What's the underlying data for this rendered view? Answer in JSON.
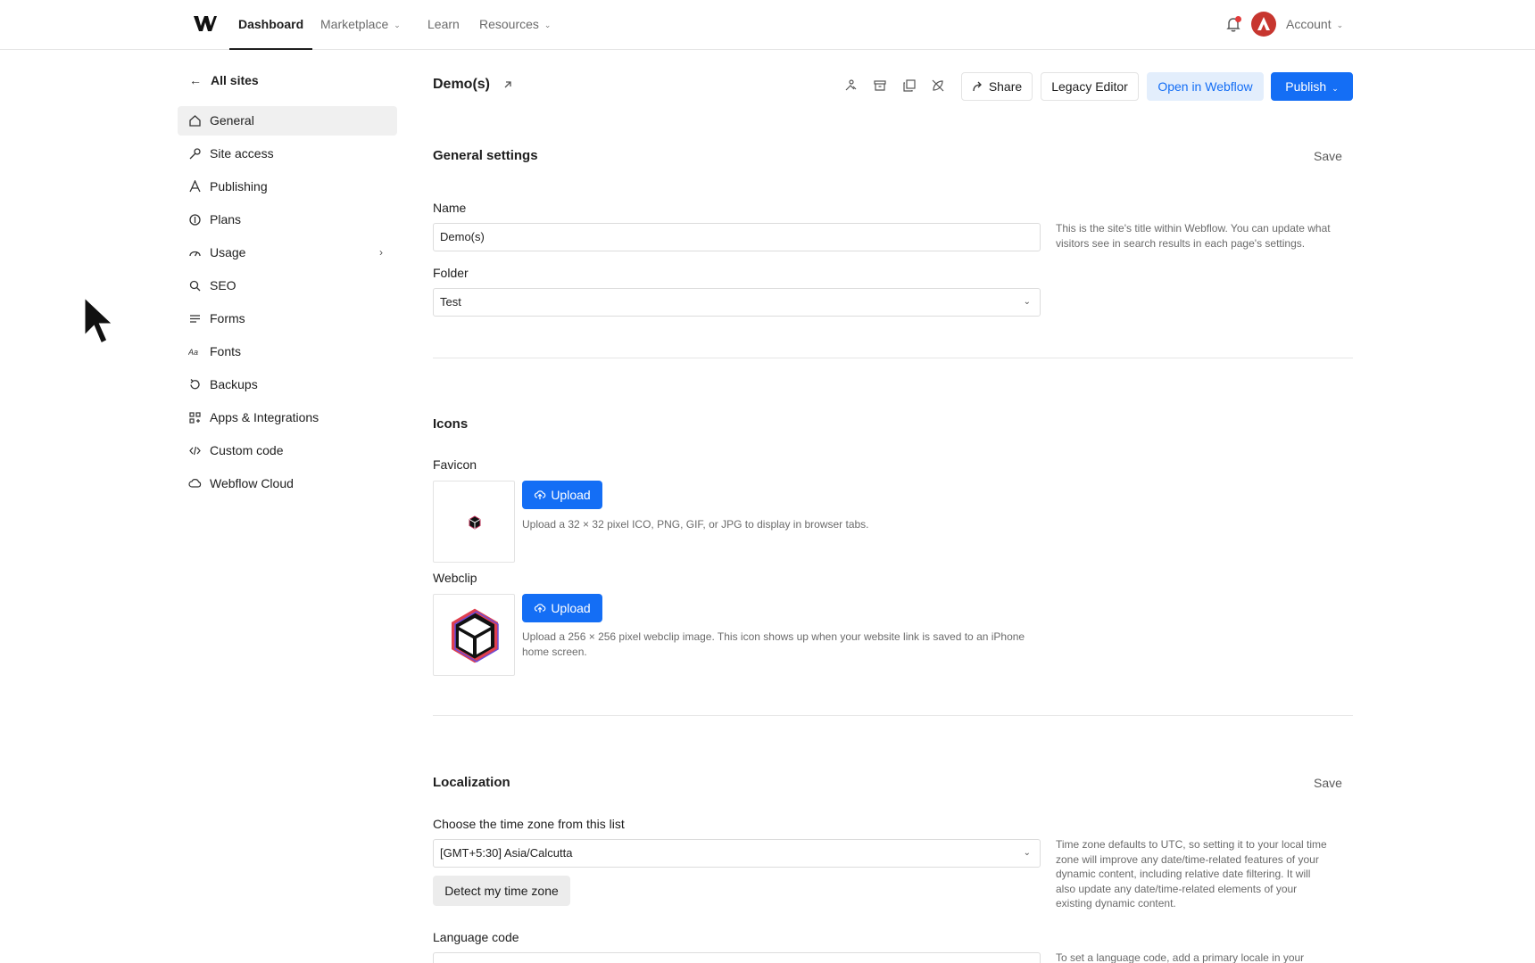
{
  "nav": {
    "dashboard": "Dashboard",
    "marketplace": "Marketplace",
    "learn": "Learn",
    "resources": "Resources",
    "account": "Account"
  },
  "sidebar": {
    "back_label": "All sites",
    "items": [
      {
        "label": "General",
        "icon": "home-icon",
        "active": true
      },
      {
        "label": "Site access",
        "icon": "key-icon"
      },
      {
        "label": "Publishing",
        "icon": "rocket-icon"
      },
      {
        "label": "Plans",
        "icon": "plans-icon"
      },
      {
        "label": "Usage",
        "icon": "gauge-icon"
      },
      {
        "label": "SEO",
        "icon": "search-icon"
      },
      {
        "label": "Forms",
        "icon": "forms-icon"
      },
      {
        "label": "Fonts",
        "icon": "fonts-icon"
      },
      {
        "label": "Backups",
        "icon": "backup-icon"
      },
      {
        "label": "Apps & Integrations",
        "icon": "apps-icon"
      },
      {
        "label": "Custom code",
        "icon": "code-icon"
      },
      {
        "label": "Webflow Cloud",
        "icon": "cloud-icon"
      }
    ]
  },
  "header": {
    "site_title": "Demo(s)",
    "share": "Share",
    "legacy_editor": "Legacy Editor",
    "open_in_webflow": "Open in Webflow",
    "publish": "Publish"
  },
  "general": {
    "title": "General settings",
    "save": "Save",
    "name_label": "Name",
    "name_value": "Demo(s)",
    "name_help": "This is the site's title within Webflow. You can update what visitors see in search results in each page's settings.",
    "folder_label": "Folder",
    "folder_value": "Test"
  },
  "icons": {
    "title": "Icons",
    "favicon_label": "Favicon",
    "favicon_upload": "Upload",
    "favicon_hint": "Upload a 32 × 32 pixel ICO, PNG, GIF, or JPG to display in browser tabs.",
    "webclip_label": "Webclip",
    "webclip_upload": "Upload",
    "webclip_hint": "Upload a 256 × 256 pixel webclip image. This icon shows up when your website link is saved to an iPhone home screen."
  },
  "localization": {
    "title": "Localization",
    "save": "Save",
    "timezone_label": "Choose the time zone from this list",
    "timezone_value": "[GMT+5:30] Asia/Calcutta",
    "timezone_help": "Time zone defaults to UTC, so setting it to your local time zone will improve any date/time-related features of your dynamic content, including relative date filtering. It will also update any date/time-related elements of your existing dynamic content.",
    "detect": "Detect my time zone",
    "language_label": "Language code",
    "language_help": "To set a language code, add a primary locale in your"
  },
  "colors": {
    "accent": "#146ef5",
    "accent_light": "#e3eefc",
    "active_bg": "#f0f0f0",
    "notification": "#e23b3b"
  }
}
